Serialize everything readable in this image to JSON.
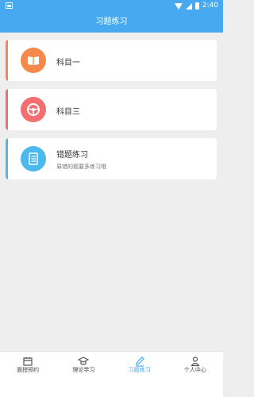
{
  "status_bar": {
    "time": "2:40"
  },
  "header": {
    "title": "习题练习"
  },
  "cards": [
    {
      "title": "科目一",
      "subtitle": "",
      "accent_color": "#f5894b",
      "icon": "book-icon"
    },
    {
      "title": "科目三",
      "subtitle": "",
      "accent_color": "#f26f6f",
      "icon": "steering-wheel-icon"
    },
    {
      "title": "错题练习",
      "subtitle": "易错的题要多练习哦",
      "accent_color": "#4bb8ee",
      "icon": "notebook-icon"
    }
  ],
  "bottom_nav": {
    "items": [
      {
        "label": "面授预约",
        "icon": "calendar-icon",
        "active": false
      },
      {
        "label": "理论学习",
        "icon": "graduation-cap-icon",
        "active": false
      },
      {
        "label": "习题练习",
        "icon": "pencil-icon",
        "active": true
      },
      {
        "label": "个人中心",
        "icon": "person-icon",
        "active": false
      }
    ]
  },
  "colors": {
    "primary": "#47aaf0",
    "background": "#eeeeee"
  }
}
